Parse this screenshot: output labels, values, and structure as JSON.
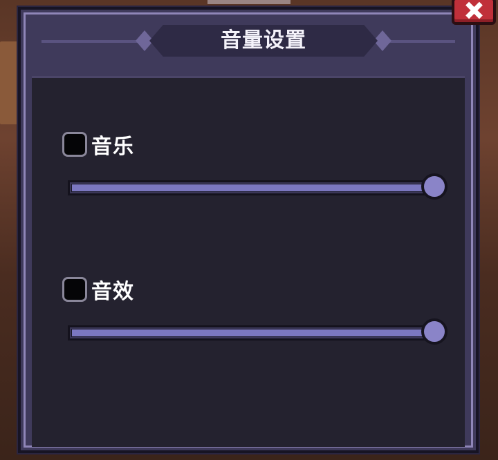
{
  "dialog": {
    "title": "音量设置"
  },
  "settings": [
    {
      "label": "音乐",
      "checked": false,
      "volume": 1.0
    },
    {
      "label": "音效",
      "checked": false,
      "volume": 1.0
    }
  ],
  "close_button": {
    "icon": "close-icon"
  },
  "colors": {
    "panel": "#3f3a5b",
    "content": "#24222f",
    "slider_fill": "#7b77c0",
    "close_button": "#c0303a"
  }
}
